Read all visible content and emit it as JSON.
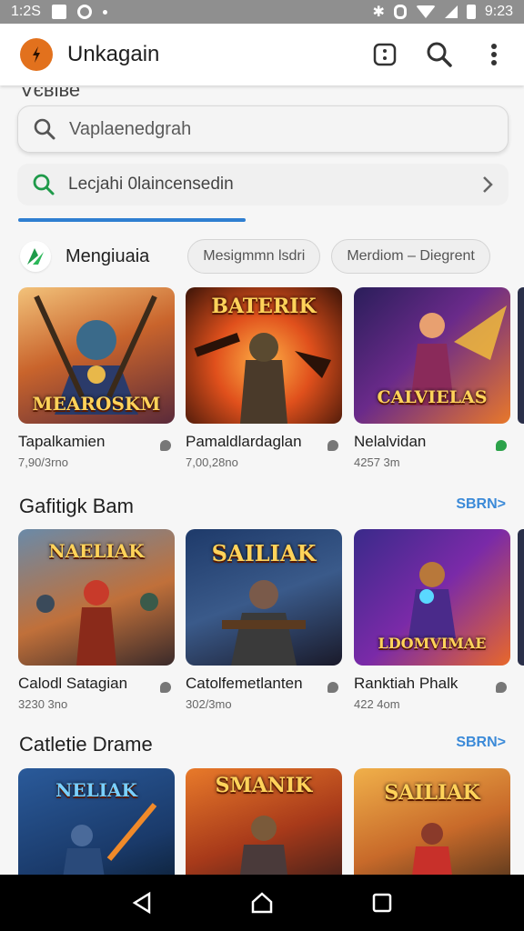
{
  "status_bar": {
    "time_left": "1:2S",
    "time_right": "9:23"
  },
  "app_bar": {
    "title": "Unkagain",
    "logo_glyph": "✦"
  },
  "cut_text": "Vєвіве",
  "search": {
    "placeholder": "Vaplaenedgrah",
    "value": ""
  },
  "suggestion": {
    "text": "Lecjahi 0laincensedin"
  },
  "filters": {
    "label": "Mengiuaia",
    "chips": [
      "Mesigmmn lsdri",
      "Merdiom – Diegrent"
    ]
  },
  "sections": [
    {
      "title": "",
      "link": "",
      "cards": [
        {
          "name": "Tapalkamien",
          "meta": "7,90/3rno",
          "art": "MEAROSKM",
          "bubble": "grey"
        },
        {
          "name": "Pamaldlardaglan",
          "meta": "7,00,28no",
          "art": "BATERIK",
          "bubble": "grey"
        },
        {
          "name": "Nelalvidan",
          "meta": "4257 3m",
          "art": "CALVIELAS",
          "bubble": "green"
        }
      ]
    },
    {
      "title": "Gafitigk Bam",
      "link": "SBRN>",
      "cards": [
        {
          "name": "Calodl Satagian",
          "meta": "3230 3no",
          "art": "NAELIAK",
          "bubble": "grey"
        },
        {
          "name": "Catolfemetlanten",
          "meta": "302/3mo",
          "art": "SAILIAK",
          "bubble": "grey"
        },
        {
          "name": "Ranktiah Phalk",
          "meta": "422 4om",
          "art": "LDOMVIMAE",
          "bubble": "grey"
        }
      ]
    },
    {
      "title": "Catletie Drame",
      "link": "SBRN>",
      "cards": [
        {
          "name": "",
          "meta": "",
          "art": "NELIAK",
          "bubble": ""
        },
        {
          "name": "",
          "meta": "",
          "art": "SMANIK",
          "bubble": ""
        },
        {
          "name": "",
          "meta": "",
          "art": "SAILIAK",
          "bubble": ""
        }
      ]
    }
  ],
  "colors": {
    "accent": "#2f7fd1",
    "logo": "#e2711d",
    "status_bar": "#8f8f8f",
    "link": "#3b8ad8"
  }
}
